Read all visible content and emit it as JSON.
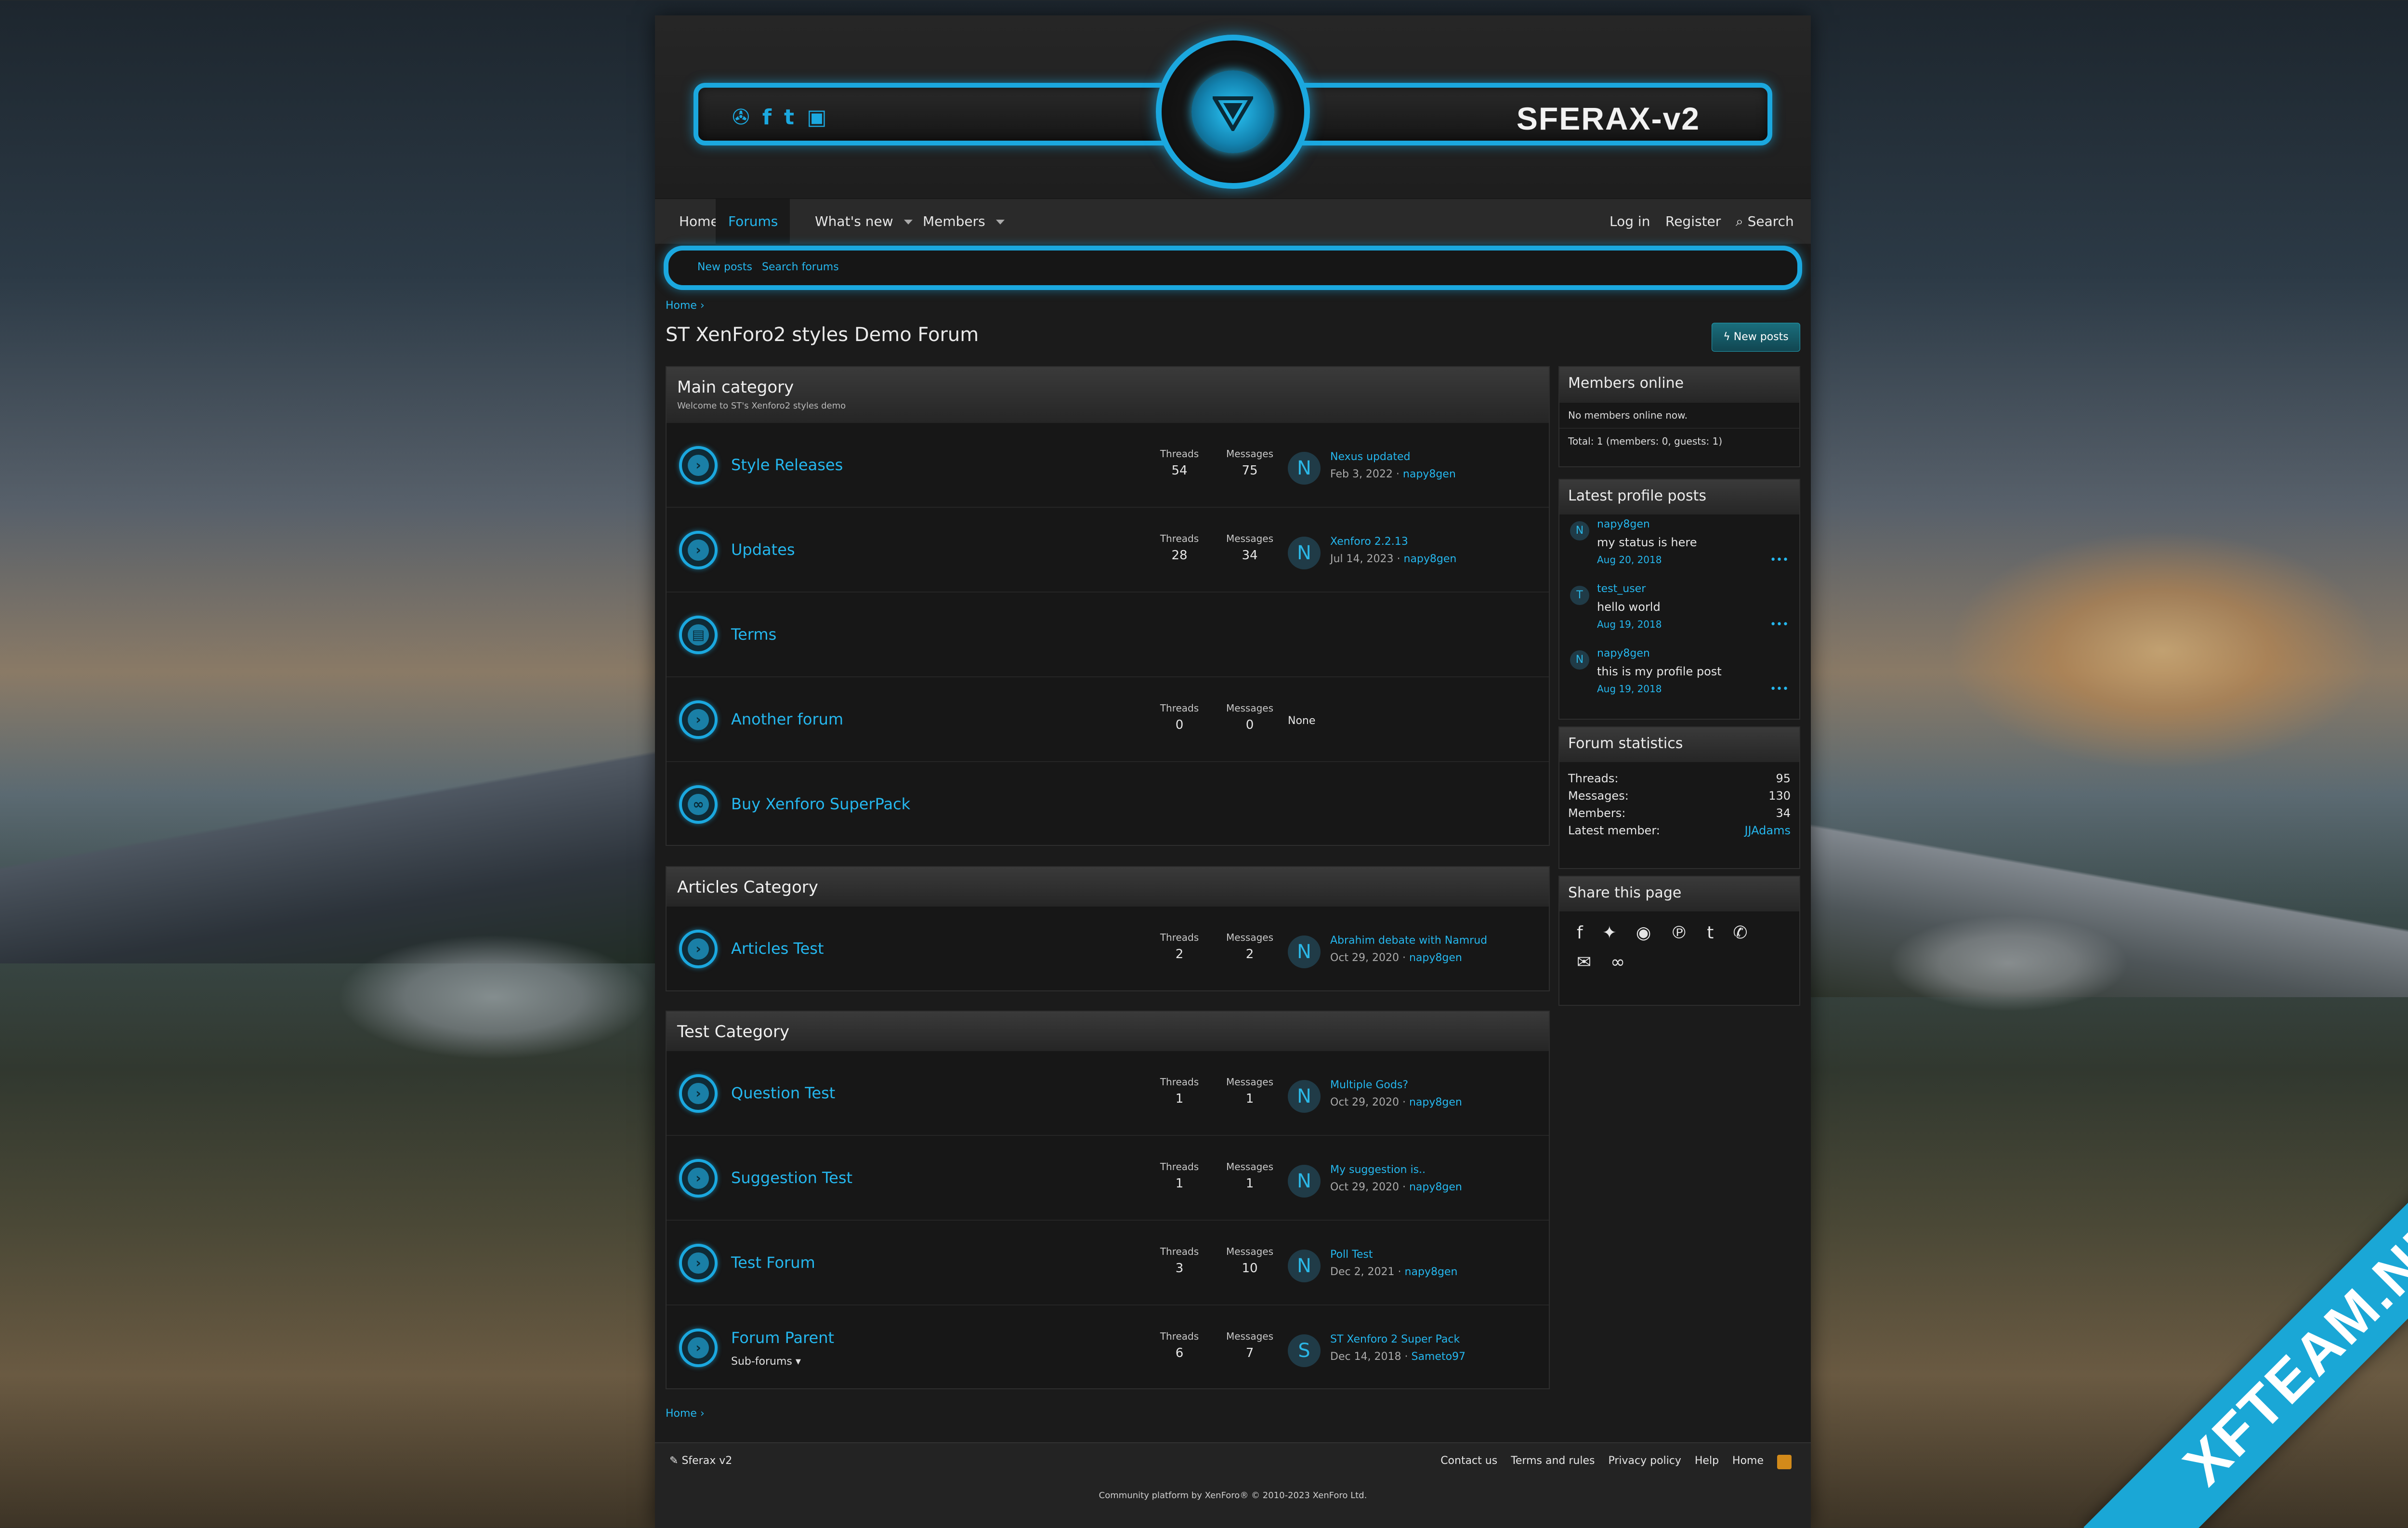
{
  "header": {
    "brand": "SFERAX-v2",
    "social": [
      "steam-icon",
      "facebook-icon",
      "twitter-icon",
      "youtube-icon"
    ]
  },
  "nav": {
    "items": [
      {
        "label": "Home"
      },
      {
        "label": "Forums",
        "active": true
      },
      {
        "label": "What's new"
      },
      {
        "label": "Members"
      }
    ],
    "right": {
      "login": "Log in",
      "register": "Register",
      "search": "Search"
    }
  },
  "subnav": {
    "new_posts": "New posts",
    "search_forums": "Search forums"
  },
  "breadcrumb": "Home",
  "page_title": "ST XenForo2 styles Demo Forum",
  "new_posts_button": "New posts",
  "categories": [
    {
      "title": "Main category",
      "description": "Welcome to ST's Xenforo2 styles demo",
      "forums": [
        {
          "title": "Style Releases",
          "threads": "54",
          "messages": "75",
          "avatar": "N",
          "last_title": "Nexus updated",
          "last_date": "Feb 3, 2022",
          "last_user": "napy8gen"
        },
        {
          "title": "Updates",
          "threads": "28",
          "messages": "34",
          "avatar": "N",
          "last_title": "Xenforo 2.2.13",
          "last_date": "Jul 14, 2023",
          "last_user": "napy8gen"
        },
        {
          "title": "Terms"
        },
        {
          "title": "Another forum",
          "threads": "0",
          "messages": "0",
          "none": "None"
        },
        {
          "title": "Buy Xenforo SuperPack"
        }
      ]
    },
    {
      "title": "Articles Category",
      "forums": [
        {
          "title": "Articles Test",
          "threads": "2",
          "messages": "2",
          "avatar": "N",
          "last_title": "Abrahim debate with Namrud",
          "last_date": "Oct 29, 2020",
          "last_user": "napy8gen"
        }
      ]
    },
    {
      "title": "Test Category",
      "forums": [
        {
          "title": "Question Test",
          "threads": "1",
          "messages": "1",
          "avatar": "N",
          "last_title": "Multiple Gods?",
          "last_date": "Oct 29, 2020",
          "last_user": "napy8gen"
        },
        {
          "title": "Suggestion Test",
          "threads": "1",
          "messages": "1",
          "avatar": "N",
          "last_title": "My suggestion is..",
          "last_date": "Oct 29, 2020",
          "last_user": "napy8gen"
        },
        {
          "title": "Test Forum",
          "threads": "3",
          "messages": "10",
          "avatar": "N",
          "last_title": "Poll Test",
          "last_date": "Dec 2, 2021",
          "last_user": "napy8gen"
        },
        {
          "title": "Forum Parent",
          "sub": "Sub-forums",
          "threads": "6",
          "messages": "7",
          "avatar": "S",
          "last_title": "ST Xenforo 2 Super Pack",
          "last_date": "Dec 14, 2018",
          "last_user": "Sameto97"
        }
      ]
    }
  ],
  "labels": {
    "threads": "Threads",
    "messages": "Messages",
    "sep": " · "
  },
  "sidebar": {
    "members_online": {
      "title": "Members online",
      "text": "No members online now.",
      "total": "Total: 1 (members: 0, guests: 1)"
    },
    "profile_posts": {
      "title": "Latest profile posts",
      "posts": [
        {
          "avatar": "N",
          "user": "napy8gen",
          "text": "my status is here",
          "date": "Aug 20, 2018",
          "more": "•••"
        },
        {
          "avatar": "T",
          "user": "test_user",
          "text": "hello world",
          "date": "Aug 19, 2018",
          "more": "•••"
        },
        {
          "avatar": "N",
          "user": "napy8gen",
          "text": "this is my profile post",
          "date": "Aug 19, 2018",
          "more": "•••"
        }
      ]
    },
    "stats": {
      "title": "Forum statistics",
      "rows": [
        {
          "k": "Threads:",
          "v": "95"
        },
        {
          "k": "Messages:",
          "v": "130"
        },
        {
          "k": "Members:",
          "v": "34"
        },
        {
          "k": "Latest member:",
          "v": "JJAdams"
        }
      ]
    },
    "share": {
      "title": "Share this page",
      "icons": [
        "facebook-icon",
        "twitter-icon",
        "reddit-icon",
        "pinterest-icon",
        "tumblr-icon",
        "whatsapp-icon",
        "email-icon",
        "link-icon"
      ]
    }
  },
  "footer": {
    "style": "Sferax v2",
    "links": [
      "Contact us",
      "Terms and rules",
      "Privacy policy",
      "Help",
      "Home"
    ],
    "copyright": "Community platform by XenForo® © 2010-2023 XenForo Ltd."
  },
  "watermark": "XFTEAM.NET"
}
